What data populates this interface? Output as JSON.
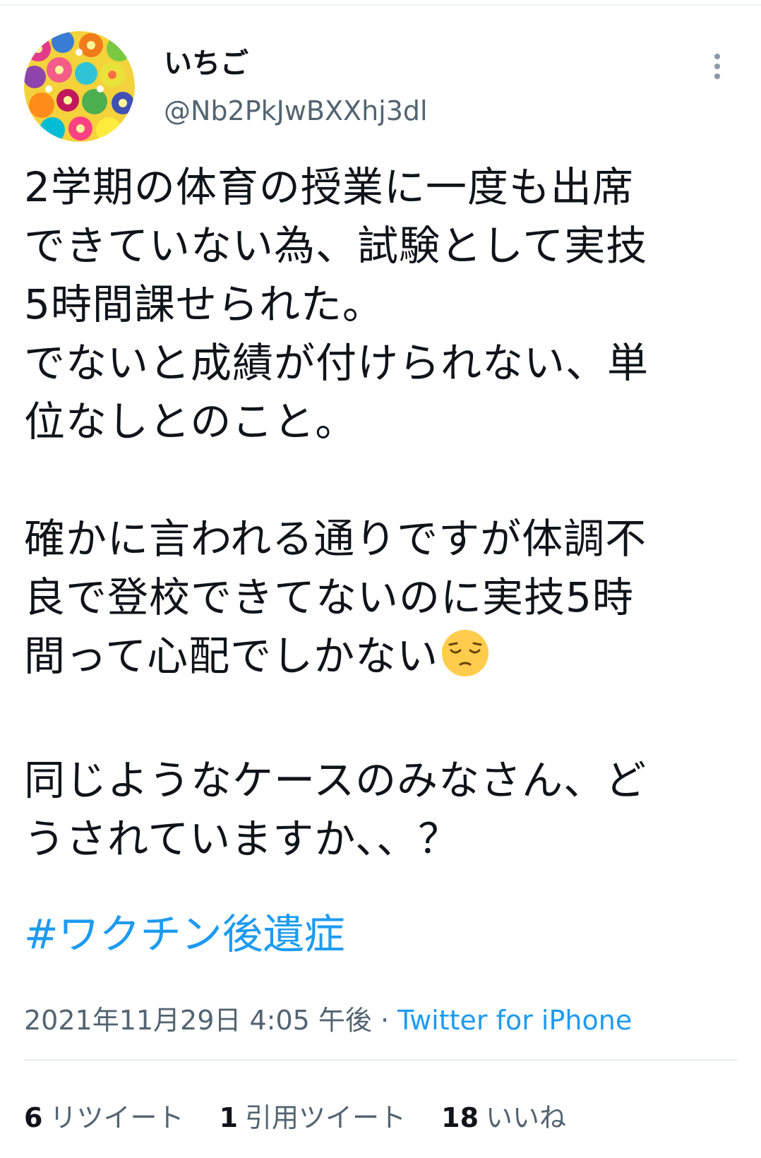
{
  "tweet": {
    "display_name": "いちご",
    "handle": "@Nb2PkJwBXXhj3dl",
    "text_main": "2学期の体育の授業に一度も出席\nできていない為、試験として実技\n5時間課せられた。\nでないと成績が付けられない、単\n位なしとのこと。\n\n確かに言われる通りですが体調不\n良で登校できてないのに実技5時\n間って心配でしかない",
    "emoji": "pensive-face",
    "text_end": "\n\n同じようなケースのみなさん、ど\nうされていますか、、？",
    "hashtag": "#ワクチン後遺症",
    "timestamp": "2021年11月29日 4:05 午後",
    "separator": " · ",
    "source": "Twitter for iPhone"
  },
  "stats": {
    "retweets": {
      "count": "6",
      "label": "リツイート"
    },
    "quotes": {
      "count": "1",
      "label": "引用ツイート"
    },
    "likes": {
      "count": "18",
      "label": "いいね"
    }
  },
  "colors": {
    "accent": "#1d9bf0",
    "secondary_text": "#536471",
    "primary_text": "#0f1419"
  },
  "icons": {
    "more": "more-vertical-icon",
    "avatar": "flower-avatar"
  }
}
